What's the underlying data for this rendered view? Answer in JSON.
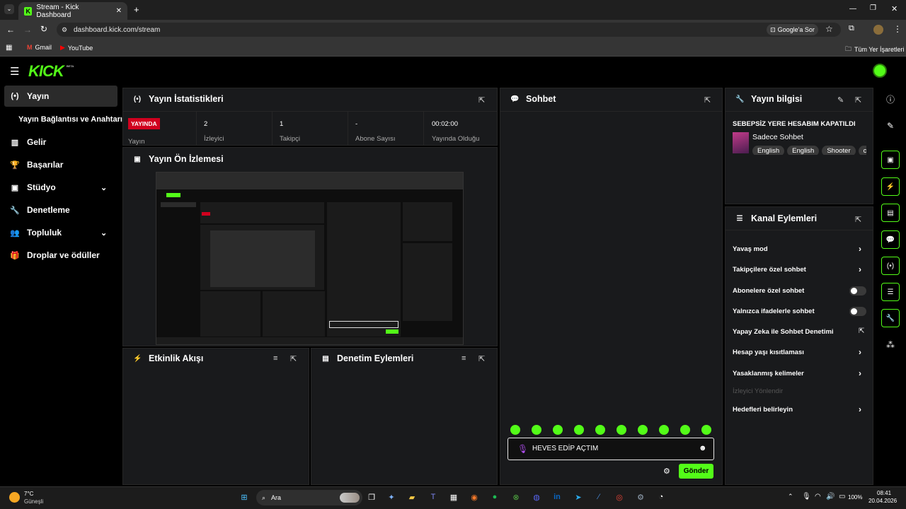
{
  "browser": {
    "tab_title": "Stream - Kick Dashboard",
    "url": "dashboard.kick.com/stream",
    "google_btn": "Google'a Sor",
    "bookmarks": [
      {
        "label": "Gmail"
      },
      {
        "label": "YouTube"
      }
    ],
    "all_bookmarks": "Tüm Yer İşaretleri"
  },
  "header": {
    "logo": "KICK",
    "beta": "BETA"
  },
  "sidebar": {
    "items": [
      {
        "label": "Yayın",
        "icon": "broadcast-icon"
      },
      {
        "label": "Yayın Bağlantısı ve Anahtarı"
      },
      {
        "label": "Gelir",
        "icon": "chart-icon"
      },
      {
        "label": "Başarılar",
        "icon": "trophy-icon"
      },
      {
        "label": "Stüdyo",
        "icon": "studio-icon"
      },
      {
        "label": "Denetleme",
        "icon": "wrench-icon"
      },
      {
        "label": "Topluluk",
        "icon": "people-icon"
      },
      {
        "label": "Droplar ve ödüller",
        "icon": "gift-icon"
      }
    ]
  },
  "stats": {
    "title": "Yayın İstatistikleri",
    "live_badge": "YAYINDA",
    "columns": [
      {
        "value": "",
        "label": "Yayın"
      },
      {
        "value": "2",
        "label": "İzleyici"
      },
      {
        "value": "1",
        "label": "Takipçi"
      },
      {
        "value": "-",
        "label": "Abone Sayısı"
      },
      {
        "value": "00:02:00",
        "label": "Yayında Olduğu"
      }
    ]
  },
  "preview": {
    "title": "Yayın Ön İzlemesi"
  },
  "activity": {
    "title": "Etkinlik Akışı"
  },
  "moderation": {
    "title": "Denetim Eylemleri"
  },
  "chat": {
    "title": "Sohbet",
    "input_value": "HEVES EDİP AÇTIM",
    "send_label": "Gönder"
  },
  "stream_info": {
    "title": "Yayın bilgisi",
    "stream_title": "SEBEPSİZ YERE HESABIM KAPATILDI",
    "category": "Sadece Sohbet",
    "tags": [
      "English",
      "English",
      "Shooter",
      "ch"
    ]
  },
  "channel_actions": {
    "title": "Kanal Eylemleri",
    "items": [
      {
        "label": "Yavaş mod"
      },
      {
        "label": "Takipçilere özel sohbet"
      },
      {
        "label": "Abonelere özel sohbet"
      },
      {
        "label": "Yalnızca ifadelerle sohbet"
      },
      {
        "label": "Yapay Zeka ile Sohbet Denetimi"
      },
      {
        "label": "Hesap yaşı kısıtlaması"
      },
      {
        "label": "Yasaklanmış kelimeler"
      },
      {
        "label": "İzleyici Yönlendir"
      },
      {
        "label": "Hedefleri belirleyin"
      }
    ]
  },
  "taskbar": {
    "weather_temp": "7°C",
    "weather_desc": "Güneşli",
    "search": "Ara",
    "battery": "100%",
    "time": "08:41",
    "date": "20.04.2026"
  },
  "colors": {
    "accent": "#53fc18",
    "live": "#d1001e",
    "panel": "#191a1c"
  }
}
